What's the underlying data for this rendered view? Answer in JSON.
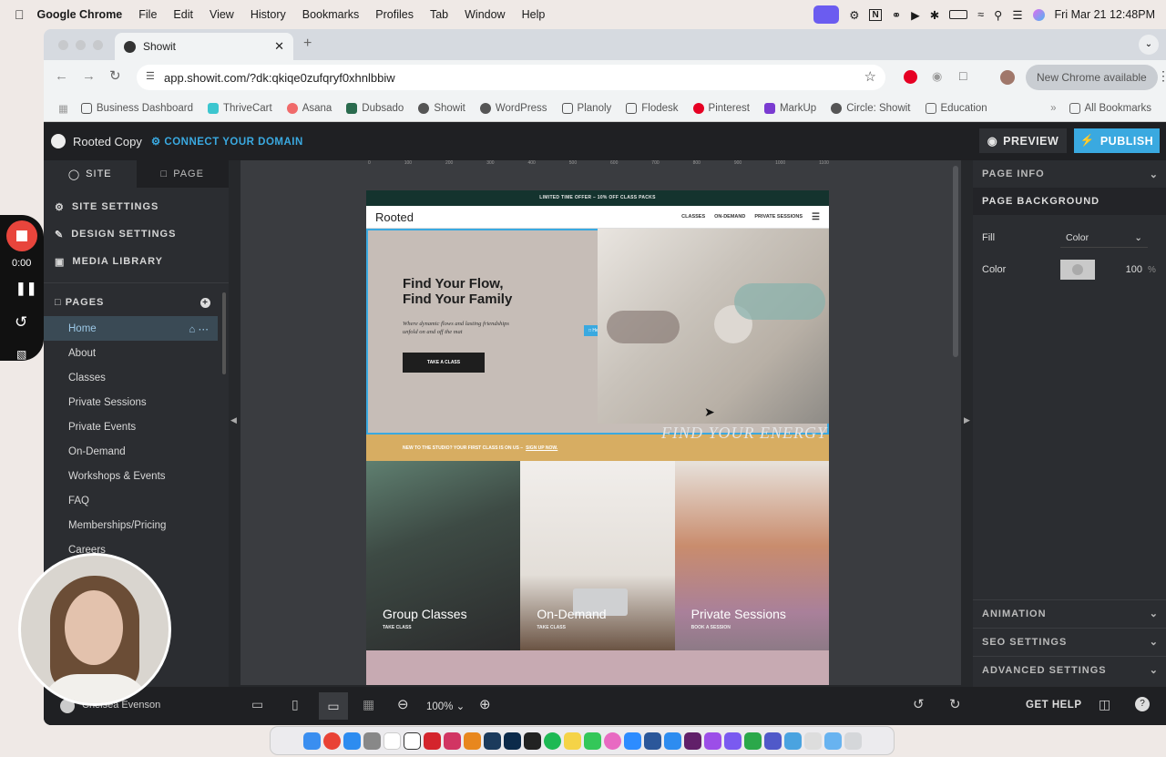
{
  "menubar": {
    "app": "Google Chrome",
    "items": [
      "File",
      "Edit",
      "View",
      "History",
      "Bookmarks",
      "Profiles",
      "Tab",
      "Window",
      "Help"
    ],
    "datetime": "Fri Mar 21  12:48PM"
  },
  "browser": {
    "tab_title": "Showit",
    "url": "app.showit.com/?dk:qkiqe0zufqryf0xhnlbbiw",
    "update_label": "New Chrome available",
    "bookmarks": [
      "Business Dashboard",
      "ThriveCart",
      "Asana",
      "Dubsado",
      "Showit",
      "WordPress",
      "Planoly",
      "Flodesk",
      "Pinterest",
      "MarkUp",
      "Circle: Showit",
      "Education"
    ],
    "all_bookmarks": "All Bookmarks"
  },
  "app": {
    "site_name": "Rooted Copy",
    "connect_domain": "CONNECT YOUR DOMAIN",
    "preview": "PREVIEW",
    "publish": "PUBLISH"
  },
  "left": {
    "tab_site": "SITE",
    "tab_page": "PAGE",
    "site_settings": "SITE SETTINGS",
    "design_settings": "DESIGN SETTINGS",
    "media_library": "MEDIA LIBRARY",
    "pages_label": "PAGES",
    "pages": [
      "Home",
      "About",
      "Classes",
      "Private Sessions",
      "Private Events",
      "On-Demand",
      "Workshops & Events",
      "FAQ",
      "Memberships/Pricing",
      "Careers"
    ],
    "user": "Chelsea Evenson"
  },
  "ruler": [
    "0",
    "100",
    "200",
    "300",
    "400",
    "500",
    "600",
    "700",
    "800",
    "900",
    "1000",
    "1100"
  ],
  "site": {
    "topbar": "LIMITED TIME OFFER – 10% OFF CLASS PACKS",
    "logo": "Rooted",
    "nav": [
      "CLASSES",
      "ON-DEMAND",
      "PRIVATE SESSIONS"
    ],
    "hero_title_1": "Find Your Flow,",
    "hero_title_2": "Find Your Family",
    "hero_sub": "Where dynamic flows and lasting friendships unfold on and off the mat",
    "cta": "TAKE A CLASS",
    "canvas_tag": "Hero",
    "overlay": "FIND YOUR ENERGY",
    "banner": "NEW TO THE STUDIO? YOUR FIRST CLASS IS ON US –",
    "banner_link": "SIGN UP NOW.",
    "cards": [
      {
        "title": "Group Classes",
        "sub": "TAKE CLASS"
      },
      {
        "title": "On-Demand",
        "sub": "TAKE CLASS"
      },
      {
        "title": "Private Sessions",
        "sub": "BOOK A SESSION"
      }
    ]
  },
  "right": {
    "page_info": "PAGE INFO",
    "page_background": "PAGE BACKGROUND",
    "fill_label": "Fill",
    "fill_value": "Color",
    "color_label": "Color",
    "opacity": "100",
    "pct": "%",
    "animation": "ANIMATION",
    "seo": "SEO SETTINGS",
    "advanced": "ADVANCED SETTINGS"
  },
  "bottom": {
    "zoom": "100%",
    "get_help": "GET HELP"
  },
  "recorder": {
    "time": "0:00"
  }
}
